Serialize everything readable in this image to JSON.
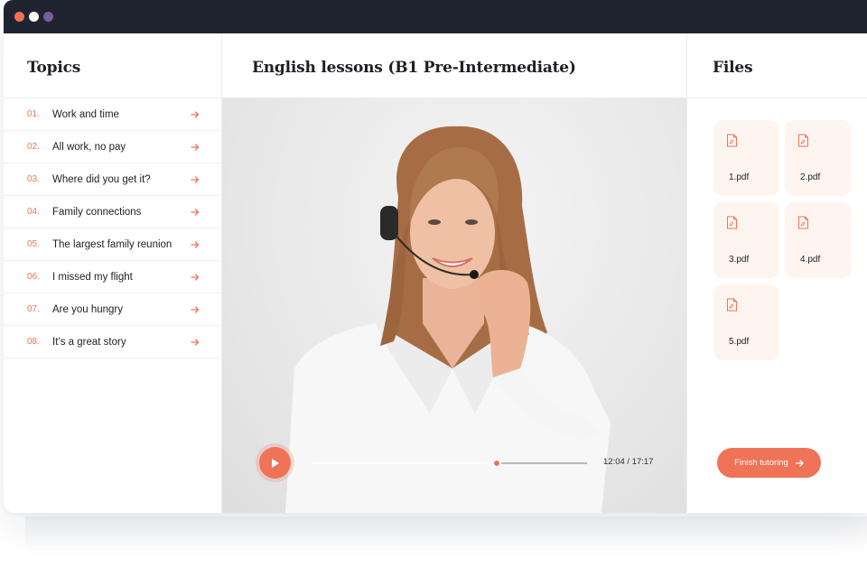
{
  "window": {
    "controls": [
      "close",
      "minimize",
      "maximize"
    ]
  },
  "topics": {
    "title": "Topics",
    "items": [
      {
        "number": "01.",
        "label": "Work and time"
      },
      {
        "number": "02.",
        "label": "All work, no pay"
      },
      {
        "number": "03.",
        "label": "Where did you get it?"
      },
      {
        "number": "04.",
        "label": "Family connections"
      },
      {
        "number": "05.",
        "label": "The largest family reunion"
      },
      {
        "number": "06.",
        "label": "I missed my flight"
      },
      {
        "number": "07.",
        "label": "Are you hungry"
      },
      {
        "number": "08.",
        "label": "It’s a great story"
      }
    ],
    "item_icon": "arrow-right-icon"
  },
  "lesson": {
    "title": "English lessons (B1 Pre-Intermediate)",
    "player": {
      "time_label": "12:04 / 17:17",
      "progress_fraction": 0.67,
      "play_icon": "play-icon"
    }
  },
  "files": {
    "title": "Files",
    "items": [
      {
        "name": "1.pdf",
        "icon": "pdf-file-icon"
      },
      {
        "name": "2.pdf",
        "icon": "pdf-file-icon"
      },
      {
        "name": "3.pdf",
        "icon": "pdf-file-icon"
      },
      {
        "name": "4.pdf",
        "icon": "pdf-file-icon"
      },
      {
        "name": "5.pdf",
        "icon": "pdf-file-icon"
      }
    ],
    "finish_label": "Finish tutoring"
  },
  "colors": {
    "accent": "#ef7356",
    "titlebar": "#1f2430",
    "file_tile": "#fff5f0"
  }
}
